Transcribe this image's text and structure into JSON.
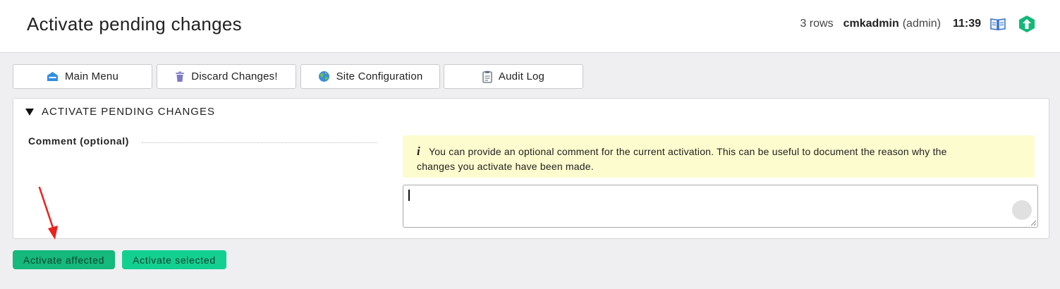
{
  "header": {
    "title": "Activate pending changes",
    "rows": "3 rows",
    "user": "cmkadmin",
    "role": "(admin)",
    "time": "11:39",
    "help_icon": "book-icon",
    "logo_icon": "checkmk-logo-icon"
  },
  "menu": [
    {
      "label": "Main Menu",
      "icon": "home-icon"
    },
    {
      "label": "Discard Changes!",
      "icon": "trash-icon"
    },
    {
      "label": "Site Configuration",
      "icon": "globe-icon"
    },
    {
      "label": "Audit Log",
      "icon": "clipboard-icon"
    }
  ],
  "panel": {
    "title": "ACTIVATE PENDING CHANGES",
    "comment_label": "Comment (optional)",
    "info_line1": "You can provide an optional comment for the current activation. This can be useful to document the reason why the",
    "info_line2": "changes you activate have been made.",
    "comment_value": ""
  },
  "actions": {
    "affected": "Activate affected",
    "selected": "Activate selected"
  },
  "colors": {
    "accent_green": "#14b97b",
    "accent_green_light": "#14d090",
    "info_bg": "#fcfcce",
    "arrow": "#e8231f"
  }
}
